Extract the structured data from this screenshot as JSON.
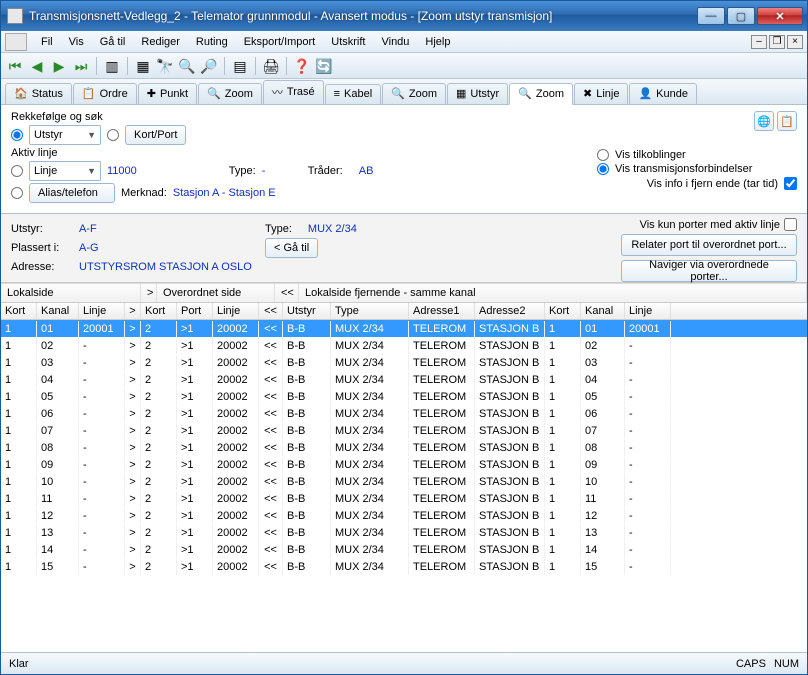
{
  "window": {
    "title": "Transmisjonsnett-Vedlegg_2 - Telemator grunnmodul - Avansert modus - [Zoom utstyr transmisjon]"
  },
  "menu": [
    "Fil",
    "Vis",
    "Gå til",
    "Rediger",
    "Ruting",
    "Eksport/Import",
    "Utskrift",
    "Vindu",
    "Hjelp"
  ],
  "tabs": [
    {
      "icon": "🏠",
      "label": "Status"
    },
    {
      "icon": "📋",
      "label": "Ordre"
    },
    {
      "icon": "✚",
      "label": "Punkt"
    },
    {
      "icon": "🔍",
      "label": "Zoom"
    },
    {
      "icon": "〰",
      "label": "Trasé"
    },
    {
      "icon": "≡",
      "label": "Kabel"
    },
    {
      "icon": "🔍",
      "label": "Zoom"
    },
    {
      "icon": "▦",
      "label": "Utstyr"
    },
    {
      "icon": "🔍",
      "label": "Zoom",
      "active": true
    },
    {
      "icon": "✖",
      "label": "Linje"
    },
    {
      "icon": "👤",
      "label": "Kunde"
    }
  ],
  "form": {
    "group1": "Rekkefølge og søk",
    "utstyr": "Utstyr",
    "kortport": "Kort/Port",
    "group2": "Aktiv linje",
    "linje": "Linje",
    "linje_val": "11000",
    "type_lbl": "Type:",
    "type_val": "-",
    "trader_lbl": "Tråder:",
    "trader_val": "AB",
    "alias": "Alias/telefon",
    "merknad_lbl": "Merknad:",
    "merknad_val": "Stasjon A - Stasjon E",
    "vis_tilk": "Vis tilkoblinger",
    "vis_trans": "Vis transmisjonsforbindelser",
    "vis_info": "Vis info i fjern ende (tar tid)"
  },
  "info": {
    "utstyr_lbl": "Utstyr:",
    "utstyr_val": "A-F",
    "plassert_lbl": "Plassert i:",
    "plassert_val": "A-G",
    "adresse_lbl": "Adresse:",
    "adresse_val": "UTSTYRSROM STASJON A OSLO",
    "type_lbl": "Type:",
    "type_val": "MUX 2/34",
    "gatil": "< Gå til",
    "aktivlinje": "Vis kun porter med aktiv linje",
    "relater": "Relater port til overordnet port...",
    "naviger": "Naviger via overordnede porter..."
  },
  "section_headers": {
    "s1": "Lokalside",
    "sgt": ">",
    "s2": "Overordnet side",
    "slt": "<<",
    "s3": "Lokalside fjernende - samme kanal"
  },
  "columns": [
    "Kort",
    "Kanal",
    "Linje",
    ">",
    "Kort",
    "Port",
    "Linje",
    "<<",
    "Utstyr",
    "Type",
    "Adresse1",
    "Adresse2",
    "Kort",
    "Kanal",
    "Linje"
  ],
  "rows": [
    {
      "k": "1",
      "ka": "01",
      "l": "20001",
      "k2": "2",
      "p": ">1",
      "l2": "20002",
      "u": "B-B",
      "t": "MUX 2/34",
      "a1": "TELEROM",
      "a2": "STASJON B",
      "k3": "1",
      "ka3": "01",
      "l3": "20001",
      "sel": true
    },
    {
      "k": "1",
      "ka": "02",
      "l": "-",
      "k2": "2",
      "p": ">1",
      "l2": "20002",
      "u": "B-B",
      "t": "MUX 2/34",
      "a1": "TELEROM",
      "a2": "STASJON B",
      "k3": "1",
      "ka3": "02",
      "l3": "-"
    },
    {
      "k": "1",
      "ka": "03",
      "l": "-",
      "k2": "2",
      "p": ">1",
      "l2": "20002",
      "u": "B-B",
      "t": "MUX 2/34",
      "a1": "TELEROM",
      "a2": "STASJON B",
      "k3": "1",
      "ka3": "03",
      "l3": "-"
    },
    {
      "k": "1",
      "ka": "04",
      "l": "-",
      "k2": "2",
      "p": ">1",
      "l2": "20002",
      "u": "B-B",
      "t": "MUX 2/34",
      "a1": "TELEROM",
      "a2": "STASJON B",
      "k3": "1",
      "ka3": "04",
      "l3": "-"
    },
    {
      "k": "1",
      "ka": "05",
      "l": "-",
      "k2": "2",
      "p": ">1",
      "l2": "20002",
      "u": "B-B",
      "t": "MUX 2/34",
      "a1": "TELEROM",
      "a2": "STASJON B",
      "k3": "1",
      "ka3": "05",
      "l3": "-"
    },
    {
      "k": "1",
      "ka": "06",
      "l": "-",
      "k2": "2",
      "p": ">1",
      "l2": "20002",
      "u": "B-B",
      "t": "MUX 2/34",
      "a1": "TELEROM",
      "a2": "STASJON B",
      "k3": "1",
      "ka3": "06",
      "l3": "-"
    },
    {
      "k": "1",
      "ka": "07",
      "l": "-",
      "k2": "2",
      "p": ">1",
      "l2": "20002",
      "u": "B-B",
      "t": "MUX 2/34",
      "a1": "TELEROM",
      "a2": "STASJON B",
      "k3": "1",
      "ka3": "07",
      "l3": "-"
    },
    {
      "k": "1",
      "ka": "08",
      "l": "-",
      "k2": "2",
      "p": ">1",
      "l2": "20002",
      "u": "B-B",
      "t": "MUX 2/34",
      "a1": "TELEROM",
      "a2": "STASJON B",
      "k3": "1",
      "ka3": "08",
      "l3": "-"
    },
    {
      "k": "1",
      "ka": "09",
      "l": "-",
      "k2": "2",
      "p": ">1",
      "l2": "20002",
      "u": "B-B",
      "t": "MUX 2/34",
      "a1": "TELEROM",
      "a2": "STASJON B",
      "k3": "1",
      "ka3": "09",
      "l3": "-"
    },
    {
      "k": "1",
      "ka": "10",
      "l": "-",
      "k2": "2",
      "p": ">1",
      "l2": "20002",
      "u": "B-B",
      "t": "MUX 2/34",
      "a1": "TELEROM",
      "a2": "STASJON B",
      "k3": "1",
      "ka3": "10",
      "l3": "-"
    },
    {
      "k": "1",
      "ka": "11",
      "l": "-",
      "k2": "2",
      "p": ">1",
      "l2": "20002",
      "u": "B-B",
      "t": "MUX 2/34",
      "a1": "TELEROM",
      "a2": "STASJON B",
      "k3": "1",
      "ka3": "11",
      "l3": "-"
    },
    {
      "k": "1",
      "ka": "12",
      "l": "-",
      "k2": "2",
      "p": ">1",
      "l2": "20002",
      "u": "B-B",
      "t": "MUX 2/34",
      "a1": "TELEROM",
      "a2": "STASJON B",
      "k3": "1",
      "ka3": "12",
      "l3": "-"
    },
    {
      "k": "1",
      "ka": "13",
      "l": "-",
      "k2": "2",
      "p": ">1",
      "l2": "20002",
      "u": "B-B",
      "t": "MUX 2/34",
      "a1": "TELEROM",
      "a2": "STASJON B",
      "k3": "1",
      "ka3": "13",
      "l3": "-"
    },
    {
      "k": "1",
      "ka": "14",
      "l": "-",
      "k2": "2",
      "p": ">1",
      "l2": "20002",
      "u": "B-B",
      "t": "MUX 2/34",
      "a1": "TELEROM",
      "a2": "STASJON B",
      "k3": "1",
      "ka3": "14",
      "l3": "-"
    },
    {
      "k": "1",
      "ka": "15",
      "l": "-",
      "k2": "2",
      "p": ">1",
      "l2": "20002",
      "u": "B-B",
      "t": "MUX 2/34",
      "a1": "TELEROM",
      "a2": "STASJON B",
      "k3": "1",
      "ka3": "15",
      "l3": "-"
    }
  ],
  "status": {
    "left": "Klar",
    "caps": "CAPS",
    "num": "NUM"
  }
}
